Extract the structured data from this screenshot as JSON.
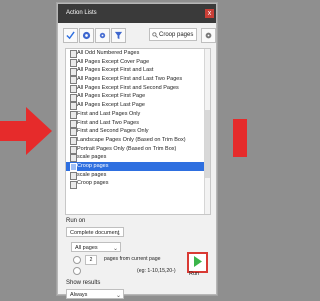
{
  "window": {
    "title": "Action Lists",
    "close_label": "x"
  },
  "toolbar": {
    "search_value": "Croop pages",
    "icons": [
      "check-icon",
      "target-icon",
      "gear-icon",
      "filter-icon",
      "search-icon",
      "gear-icon"
    ]
  },
  "list": {
    "items": [
      "All Odd Numbered Pages",
      "All Pages Except Cover Page",
      "All Pages Except First and Last",
      "All Pages Except First and Last Two Pages",
      "All Pages Except First and Second Pages",
      "All Pages Except First Page",
      "All Pages Except Last Page",
      "First and Last Pages Only",
      "First and Last Two Pages",
      "First and Second Pages Only",
      "Landscape Pages Only (Based on Trim Box)",
      "Portrait Pages Only (Based on Trim Box)",
      "scale pages",
      "Croop pages",
      "scale pages",
      "Croop pages"
    ],
    "selected_index": 13
  },
  "run_on": {
    "label": "Run on",
    "document_option": "Complete document",
    "pages_option": "All pages",
    "from_value": "2",
    "from_label": "pages from current page",
    "example_text": "(eg: 1-10,15,20-)"
  },
  "results": {
    "label": "Show results",
    "value": "Always"
  },
  "run_button": {
    "label": "Run"
  },
  "colors": {
    "accent": "#2e6fe0",
    "arrow_red": "#e62b2b",
    "run_green": "#3ab54a"
  }
}
